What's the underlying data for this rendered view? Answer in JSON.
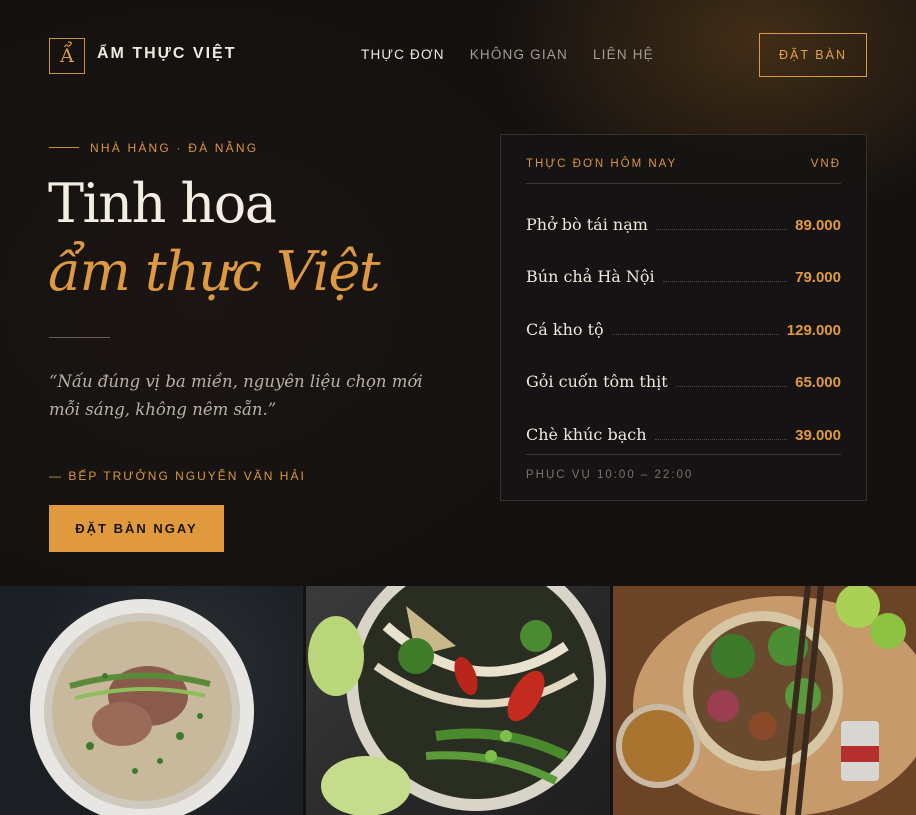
{
  "brand": {
    "logo_letter": "Ẩ",
    "name": "ẨM THỰC VIỆT"
  },
  "nav": {
    "items": [
      "THỰC ĐƠN",
      "KHÔNG GIAN",
      "LIÊN HỆ"
    ],
    "active": 0
  },
  "header": {
    "reserve_label": "ĐẶT BÀN"
  },
  "hero": {
    "eyebrow": "NHÀ HÀNG · ĐÀ NẴNG",
    "title_line1": "Tinh hoa",
    "title_line2": "ẩm thực Việt",
    "quote": "“Nấu đúng vị ba miền, nguyên liệu chọn mới mỗi sáng, không nêm sẵn.”",
    "author": "— BẾP TRƯỞNG NGUYỄN VĂN HẢI",
    "cta_label": "ĐẶT BÀN NGAY"
  },
  "menu": {
    "heading": "THỰC ĐƠN HÔM NAY",
    "currency": "VNĐ",
    "items": [
      {
        "name": "Phở bò tái nạm",
        "price": "89.000"
      },
      {
        "name": "Bún chả Hà Nội",
        "price": "79.000"
      },
      {
        "name": "Cá kho tộ",
        "price": "129.000"
      },
      {
        "name": "Gỏi cuốn tôm thịt",
        "price": "65.000"
      },
      {
        "name": "Chè khúc bạch",
        "price": "39.000"
      }
    ],
    "hours": "PHỤC VỤ 10:00 – 22:00"
  },
  "colors": {
    "accent": "#e09a3d",
    "background": "#141110",
    "text": "#efe9df"
  },
  "gallery": {
    "items": [
      "pho-bowl-photo",
      "noodle-bowl-photo",
      "salad-bowl-photo"
    ]
  }
}
